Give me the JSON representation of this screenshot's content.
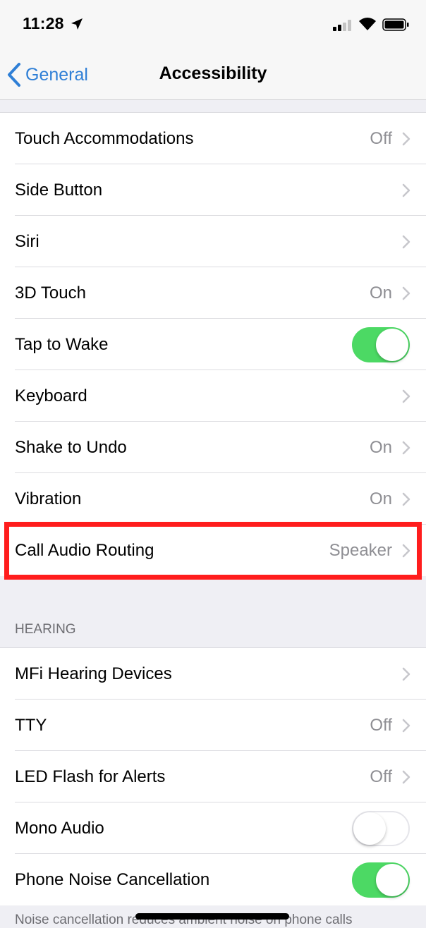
{
  "status_bar": {
    "time": "11:28",
    "icons": [
      "location-arrow-icon",
      "cellular-signal-icon",
      "wifi-icon",
      "battery-icon"
    ]
  },
  "nav": {
    "back_label": "General",
    "title": "Accessibility"
  },
  "interaction_group": {
    "rows": [
      {
        "label": "Touch Accommodations",
        "value": "Off",
        "type": "disclosure"
      },
      {
        "label": "Side Button",
        "value": "",
        "type": "disclosure"
      },
      {
        "label": "Siri",
        "value": "",
        "type": "disclosure"
      },
      {
        "label": "3D Touch",
        "value": "On",
        "type": "disclosure"
      },
      {
        "label": "Tap to Wake",
        "type": "toggle",
        "on": true
      },
      {
        "label": "Keyboard",
        "value": "",
        "type": "disclosure"
      },
      {
        "label": "Shake to Undo",
        "value": "On",
        "type": "disclosure"
      },
      {
        "label": "Vibration",
        "value": "On",
        "type": "disclosure"
      },
      {
        "label": "Call Audio Routing",
        "value": "Speaker",
        "type": "disclosure",
        "highlighted": true
      }
    ]
  },
  "hearing_group": {
    "header": "HEARING",
    "rows": [
      {
        "label": "MFi Hearing Devices",
        "value": "",
        "type": "disclosure"
      },
      {
        "label": "TTY",
        "value": "Off",
        "type": "disclosure"
      },
      {
        "label": "LED Flash for Alerts",
        "value": "Off",
        "type": "disclosure"
      },
      {
        "label": "Mono Audio",
        "type": "toggle",
        "on": false
      },
      {
        "label": "Phone Noise Cancellation",
        "type": "toggle",
        "on": true
      }
    ],
    "footer": "Noise cancellation reduces ambient noise on phone calls"
  },
  "colors": {
    "accent": "#2f7fd6",
    "toggle_on": "#4cd964",
    "highlight": "#ff1d1d",
    "secondary_text": "#8e8e93"
  }
}
